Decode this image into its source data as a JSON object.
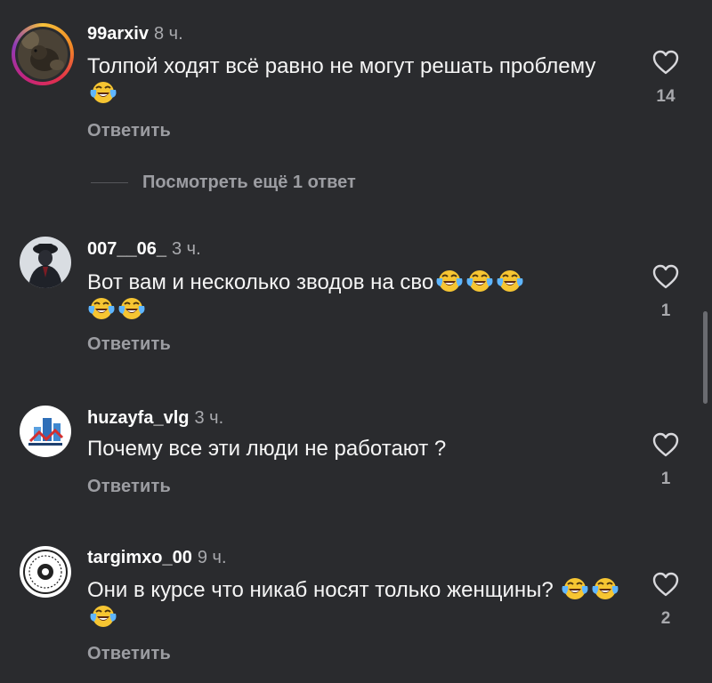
{
  "comments": [
    {
      "username": "99arxiv",
      "time": "8 ч.",
      "text": "Толпой ходят всё равно не могут решать проблему",
      "emoji_count": 1,
      "reply_label": "Ответить",
      "likes": "14",
      "has_story_ring": true,
      "avatar": "rat-photo-avatar"
    },
    {
      "username": "007__06_",
      "time": "3 ч.",
      "text": "Вот вам и несколько зводов на сво",
      "emoji_count": 5,
      "reply_label": "Ответить",
      "likes": "1",
      "has_story_ring": false,
      "avatar": "man-in-hat-avatar"
    },
    {
      "username": "huzayfa_vlg",
      "time": "3 ч.",
      "text": "Почему все эти люди не работают ?",
      "emoji_count": 0,
      "reply_label": "Ответить",
      "likes": "1",
      "has_story_ring": false,
      "avatar": "buildings-logo-avatar"
    },
    {
      "username": "targimxo_00",
      "time": "9 ч.",
      "text": "Они в курсе что никаб носят только женщины?",
      "emoji_count": 3,
      "reply_label": "Ответить",
      "likes": "2",
      "has_story_ring": false,
      "avatar": "circular-emblem-avatar"
    }
  ],
  "more_replies": {
    "label": "Посмотреть ещё 1 ответ"
  },
  "emoji": {
    "name": "face-with-tears-of-joy-emoji"
  },
  "colors": {
    "background": "#2a2b2e",
    "text_primary": "#f5f5f5",
    "text_secondary": "#9c9da2",
    "heart_outline": "#d8d8dc"
  }
}
